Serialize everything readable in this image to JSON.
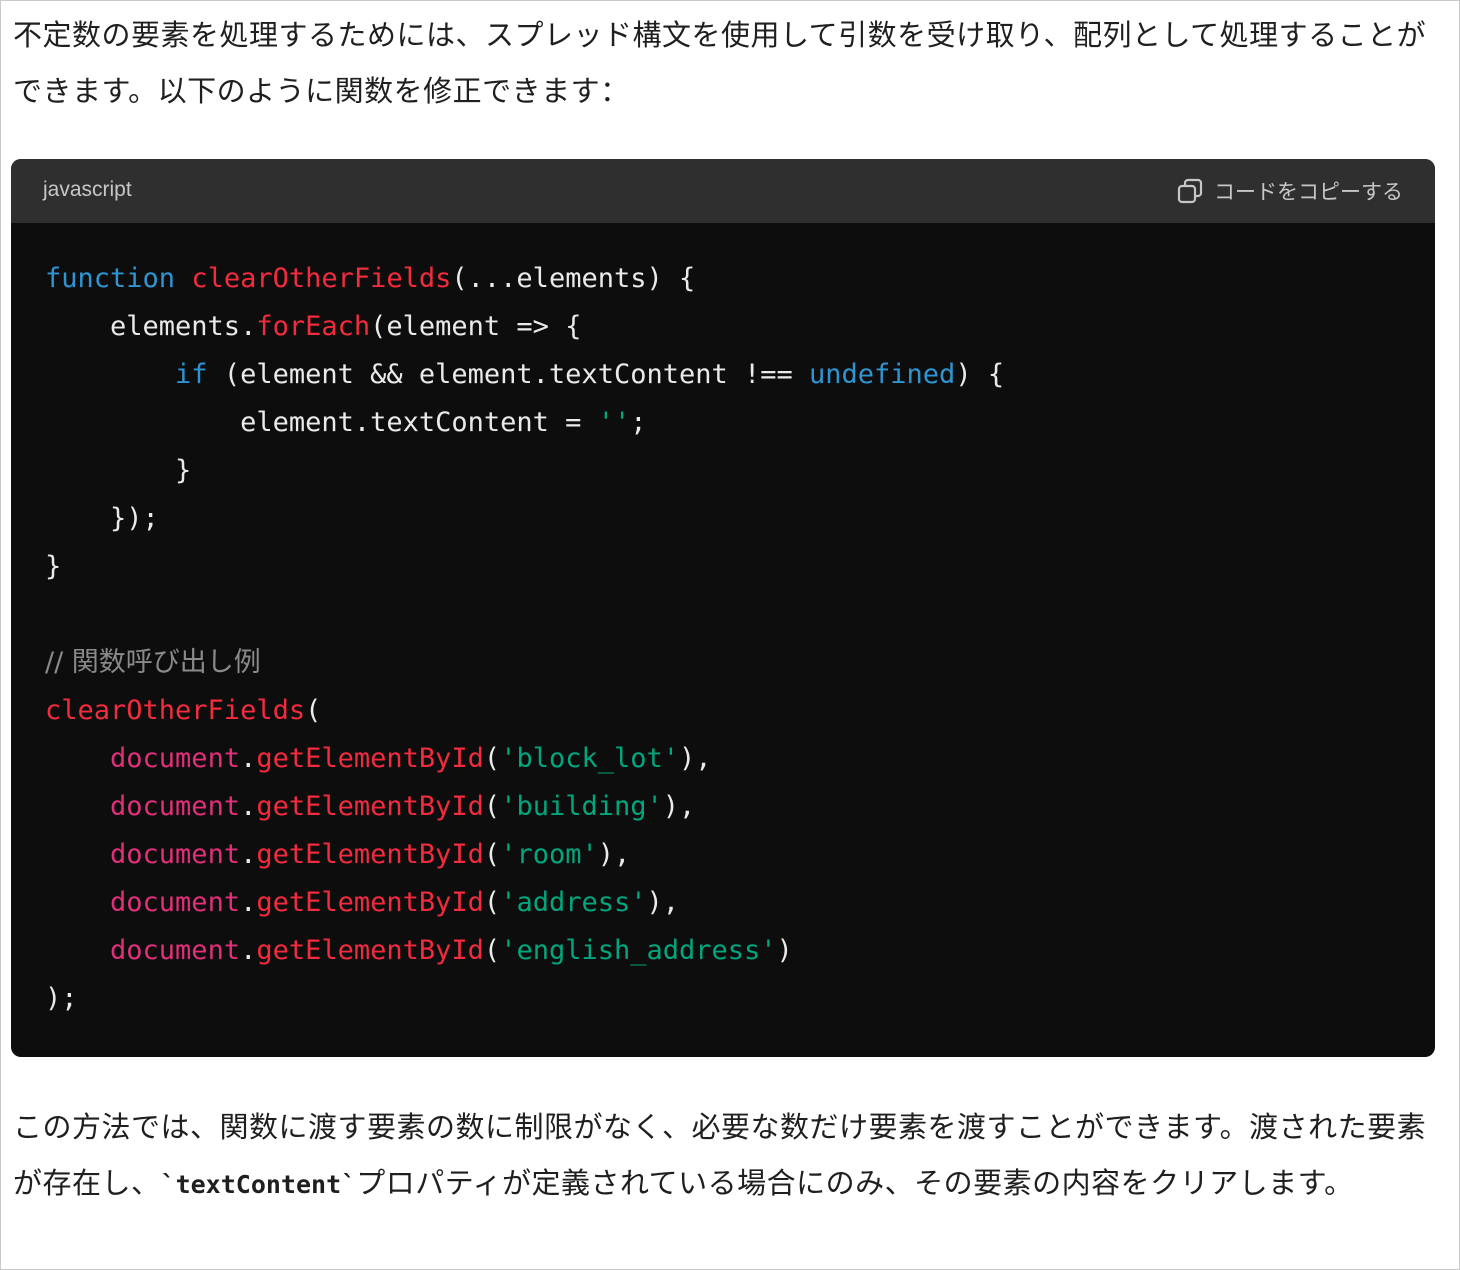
{
  "intro_text": "不定数の要素を処理するためには、スプレッド構文を使用して引数を受け取り、配列として処理することができます。以下のように関数を修正できます：",
  "code_block": {
    "language": "javascript",
    "copy_label": "コードをコピーする",
    "copy_icon": "copy-icon",
    "lines": [
      [
        {
          "t": "kw",
          "v": "function"
        },
        {
          "t": "txt",
          "v": " "
        },
        {
          "t": "fn",
          "v": "clearOtherFields"
        },
        {
          "t": "txt",
          "v": "(...elements) {"
        }
      ],
      [
        {
          "t": "txt",
          "v": "    elements."
        },
        {
          "t": "fn",
          "v": "forEach"
        },
        {
          "t": "txt",
          "v": "(element => {"
        }
      ],
      [
        {
          "t": "txt",
          "v": "        "
        },
        {
          "t": "kw",
          "v": "if"
        },
        {
          "t": "txt",
          "v": " (element && element.textContent !== "
        },
        {
          "t": "kw",
          "v": "undefined"
        },
        {
          "t": "txt",
          "v": ") {"
        }
      ],
      [
        {
          "t": "txt",
          "v": "            element.textContent = "
        },
        {
          "t": "str",
          "v": "''"
        },
        {
          "t": "txt",
          "v": ";"
        }
      ],
      [
        {
          "t": "txt",
          "v": "        }"
        }
      ],
      [
        {
          "t": "txt",
          "v": "    });"
        }
      ],
      [
        {
          "t": "txt",
          "v": "}"
        }
      ],
      [],
      [
        {
          "t": "cm",
          "v": "// 関数呼び出し例"
        }
      ],
      [
        {
          "t": "fn",
          "v": "clearOtherFields"
        },
        {
          "t": "txt",
          "v": "("
        }
      ],
      [
        {
          "t": "txt",
          "v": "    "
        },
        {
          "t": "obj",
          "v": "document"
        },
        {
          "t": "txt",
          "v": "."
        },
        {
          "t": "fn",
          "v": "getElementById"
        },
        {
          "t": "txt",
          "v": "("
        },
        {
          "t": "str",
          "v": "'block_lot'"
        },
        {
          "t": "txt",
          "v": "),"
        }
      ],
      [
        {
          "t": "txt",
          "v": "    "
        },
        {
          "t": "obj",
          "v": "document"
        },
        {
          "t": "txt",
          "v": "."
        },
        {
          "t": "fn",
          "v": "getElementById"
        },
        {
          "t": "txt",
          "v": "("
        },
        {
          "t": "str",
          "v": "'building'"
        },
        {
          "t": "txt",
          "v": "),"
        }
      ],
      [
        {
          "t": "txt",
          "v": "    "
        },
        {
          "t": "obj",
          "v": "document"
        },
        {
          "t": "txt",
          "v": "."
        },
        {
          "t": "fn",
          "v": "getElementById"
        },
        {
          "t": "txt",
          "v": "("
        },
        {
          "t": "str",
          "v": "'room'"
        },
        {
          "t": "txt",
          "v": "),"
        }
      ],
      [
        {
          "t": "txt",
          "v": "    "
        },
        {
          "t": "obj",
          "v": "document"
        },
        {
          "t": "txt",
          "v": "."
        },
        {
          "t": "fn",
          "v": "getElementById"
        },
        {
          "t": "txt",
          "v": "("
        },
        {
          "t": "str",
          "v": "'address'"
        },
        {
          "t": "txt",
          "v": "),"
        }
      ],
      [
        {
          "t": "txt",
          "v": "    "
        },
        {
          "t": "obj",
          "v": "document"
        },
        {
          "t": "txt",
          "v": "."
        },
        {
          "t": "fn",
          "v": "getElementById"
        },
        {
          "t": "txt",
          "v": "("
        },
        {
          "t": "str",
          "v": "'english_address'"
        },
        {
          "t": "txt",
          "v": ")"
        }
      ],
      [
        {
          "t": "txt",
          "v": ");"
        }
      ]
    ]
  },
  "outro_text": {
    "part1": "この方法では、関数に渡す要素の数に制限がなく、必要な数だけ要素を渡すことができます。渡された要素が存在し、",
    "code": "`textContent`",
    "part2": "プロパティが定義されている場合にのみ、その要素の内容をクリアします。"
  },
  "colors": {
    "keyword": "#2e95d3",
    "function": "#f22c3d",
    "object": "#df3079",
    "string": "#00a67d",
    "comment": "#8a8a8a",
    "code_background": "#0d0d0d",
    "header_background": "#2f2f2f"
  }
}
